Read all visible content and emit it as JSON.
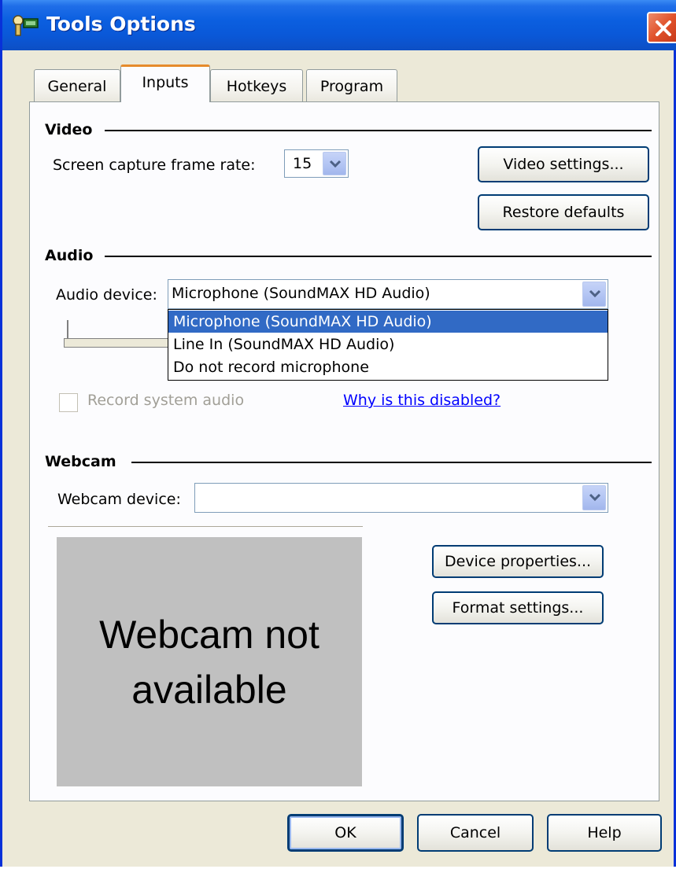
{
  "window": {
    "title": "Tools Options"
  },
  "tabs": [
    {
      "label": "General",
      "active": false
    },
    {
      "label": "Inputs",
      "active": true
    },
    {
      "label": "Hotkeys",
      "active": false
    },
    {
      "label": "Program",
      "active": false
    }
  ],
  "video": {
    "section_title": "Video",
    "frame_rate_label": "Screen capture frame rate:",
    "frame_rate_value": "15",
    "video_settings_button": "Video settings...",
    "restore_defaults_button": "Restore defaults"
  },
  "audio": {
    "section_title": "Audio",
    "device_label": "Audio device:",
    "device_value": "Microphone (SoundMAX HD Audio)",
    "options": [
      "Microphone (SoundMAX HD Audio)",
      "Line In (SoundMAX HD Audio)",
      "Do not record microphone"
    ],
    "selected_index": 0,
    "record_system_audio_label": "Record system audio",
    "record_system_audio_checked": false,
    "why_disabled_link": "Why is this disabled?"
  },
  "webcam": {
    "section_title": "Webcam",
    "device_label": "Webcam device:",
    "device_value": "",
    "preview_line1": "Webcam not",
    "preview_line2": "available",
    "device_properties_button": "Device properties...",
    "format_settings_button": "Format settings..."
  },
  "footer": {
    "ok_button": "OK",
    "cancel_button": "Cancel",
    "help_button": "Help"
  },
  "colors": {
    "titlebar": "#0b5fe0",
    "selection": "#316ac5",
    "active_tab_accent": "#e68b2c",
    "link": "#0000ff"
  }
}
